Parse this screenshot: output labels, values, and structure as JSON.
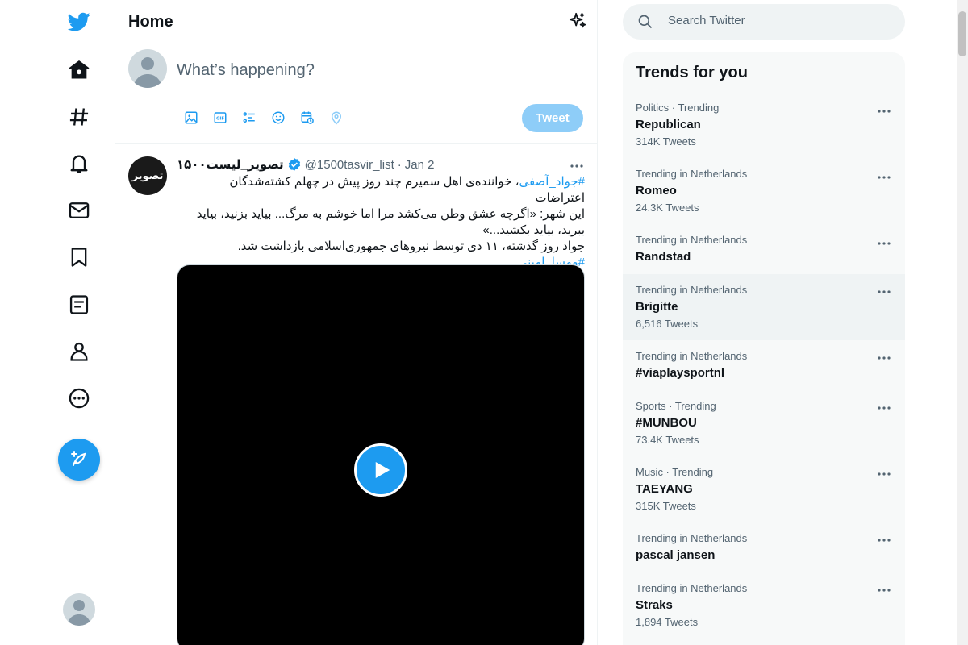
{
  "nav": {
    "items": [
      {
        "icon": "twitter-logo-icon"
      },
      {
        "icon": "home-icon"
      },
      {
        "icon": "explore-hashtag-icon"
      },
      {
        "icon": "notifications-bell-icon"
      },
      {
        "icon": "messages-envelope-icon"
      },
      {
        "icon": "bookmark-icon"
      },
      {
        "icon": "lists-icon"
      },
      {
        "icon": "profile-icon"
      },
      {
        "icon": "more-circle-icon"
      }
    ],
    "compose_icon": "compose-tweet-icon"
  },
  "main": {
    "title": "Home",
    "composer": {
      "placeholder": "What’s happening?",
      "tweet_label": "Tweet"
    },
    "tweet": {
      "avatar_text": "تصویر",
      "name": "تصویر_لیست۱۵۰۰",
      "handle": "@1500tasvir_list",
      "dot": "·",
      "date": "Jan 2",
      "text_lines": {
        "l1_hashtag": "#جواد_آصفی",
        "l1_rest": "، خواننده‌ی اهل سمیرم چند روز پیش در چهلم کشته‌شدگان اعتراضات",
        "l2": "این شهر: «اگرچه عشق وطن می‌کشد مرا اما خوشم به مرگ... بیاید بزنید، بیاید",
        "l3": "ببرید، بیاید بکشید...»",
        "l4": "جواد روز گذشته، ۱۱ دی توسط نیروهای جمهوری‌اسلامی بازداشت شد.",
        "l5_hashtag": "#مهسا_امینی"
      }
    }
  },
  "sidebar": {
    "search_placeholder": "Search Twitter",
    "trends_title": "Trends for you",
    "trends": [
      {
        "context": "Politics · Trending",
        "name": "Republican",
        "count": "314K Tweets"
      },
      {
        "context": "Trending in Netherlands",
        "name": "Romeo",
        "count": "24.3K Tweets"
      },
      {
        "context": "Trending in Netherlands",
        "name": "Randstad",
        "count": ""
      },
      {
        "context": "Trending in Netherlands",
        "name": "Brigitte",
        "count": "6,516 Tweets"
      },
      {
        "context": "Trending in Netherlands",
        "name": "#viaplaysportnl",
        "count": ""
      },
      {
        "context": "Sports · Trending",
        "name": "#MUNBOU",
        "count": "73.4K Tweets"
      },
      {
        "context": "Music · Trending",
        "name": "TAEYANG",
        "count": "315K Tweets"
      },
      {
        "context": "Trending in Netherlands",
        "name": "pascal jansen",
        "count": ""
      },
      {
        "context": "Trending in Netherlands",
        "name": "Straks",
        "count": "1,894 Tweets"
      }
    ]
  },
  "colors": {
    "accent": "#1d9bf0",
    "tweet_button_disabled": "#8ecdf8",
    "secondary_text": "#536471"
  }
}
